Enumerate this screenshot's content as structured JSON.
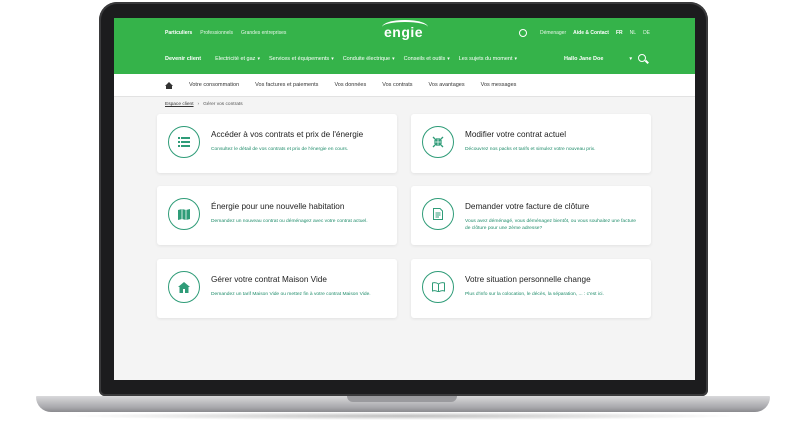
{
  "header": {
    "segments": [
      "Particuliers",
      "Professionnels",
      "Grandes entreprises"
    ],
    "logo": "engie",
    "utils": {
      "manager": "Démenager",
      "help": "Aide & Contact",
      "langs": [
        "FR",
        "NL",
        "DE"
      ]
    },
    "nav": [
      "Devenir client",
      "Electricité et gaz",
      "Services et équipements",
      "Conduite électrique",
      "Conseils et outils",
      "Les sujets du moment"
    ],
    "user": "Hallo Jane Doe"
  },
  "subnav": [
    "Votre consommation",
    "Vos factures et paiements",
    "Vos données",
    "Vos contrats",
    "Vos avantages",
    "Vos messages"
  ],
  "breadcrumb": {
    "root": "Espace client",
    "current": "Gérer vos contrats"
  },
  "cards": [
    {
      "title": "Accéder à vos contrats et prix de l'énergie",
      "desc": "Consultez le détail de vos contrats et prix de l'énergie en cours."
    },
    {
      "title": "Modifier votre contrat actuel",
      "desc": "Découvrez nos packs et tarifs et simulez votre nouveau prix."
    },
    {
      "title": "Énergie pour une nouvelle habitation",
      "desc": "Demandez un nouveau contrat ou déménagez avec votre contrat actuel."
    },
    {
      "title": "Demander votre facture de clôture",
      "desc": "Vous avez déménagé, vous déménagez bientôt, ou vous souhaitez une facture de clôture pour une 2ème adresse?"
    },
    {
      "title": "Gérer votre contrat Maison Vide",
      "desc": "Demandez un tarif Maison Vide ou mettez fin à votre contrat Maison Vide."
    },
    {
      "title": "Votre situation personnelle change",
      "desc": "Plus d'info sur la colocation, le décès, la séparation, ... : c'est ici."
    }
  ],
  "colors": {
    "brand": "#35b34a",
    "accent": "#2f9c78"
  }
}
